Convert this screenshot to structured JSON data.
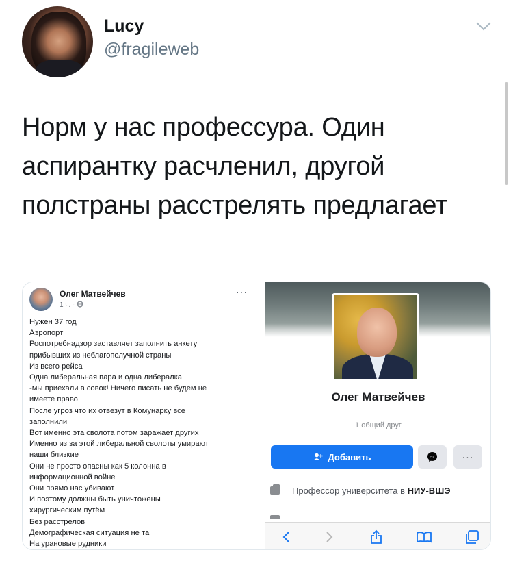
{
  "tweet": {
    "author_name": "Lucy",
    "author_handle": "@fragileweb",
    "text": "Норм у нас профессура. Один аспирантку расчленил, другой полстраны расстрелять предлагает"
  },
  "fb_post": {
    "author": "Олег Матвейчев",
    "meta": "1 ч. · ",
    "menu": "···",
    "lines": [
      "Нужен 37 год",
      "Аэропорт",
      "Роспотребнадзор заставляет заполнить анкету",
      "прибывших из неблагополучной страны",
      "Из всего рейса",
      "Одна либеральная пара и одна либералка",
      "-мы приехали в совок! Ничего писать не будем не",
      "имеете право",
      "После угроз что их отвезут в Комунарку все",
      "заполнили",
      "Вот именно эта сволота потом заражает других",
      "Именно из за этой либеральной сволоты умирают",
      "наши близкие",
      "Они не просто опасны как 5 колонна в",
      "информационной войне",
      "Они прямо нас убивают",
      "И поэтому должны быть уничтожены",
      "хирургическим путём",
      "Без расстрелов",
      "Демографическая ситуация не та",
      "На урановые рудники"
    ]
  },
  "fb_profile": {
    "name": "Олег Матвейчев",
    "mutual_friends": "1 общий друг",
    "add_button": "Добавить",
    "more": "···",
    "work_prefix": "Профессор университета в ",
    "work_org": "НИУ-ВШЭ"
  },
  "icons": {
    "chevron": "chevron-down-icon",
    "add_friend": "add-friend-icon",
    "messenger": "messenger-icon",
    "globe": "globe-icon"
  },
  "colors": {
    "fb_blue": "#1877f2",
    "twitter_gray": "#657786",
    "text": "#14171a"
  }
}
